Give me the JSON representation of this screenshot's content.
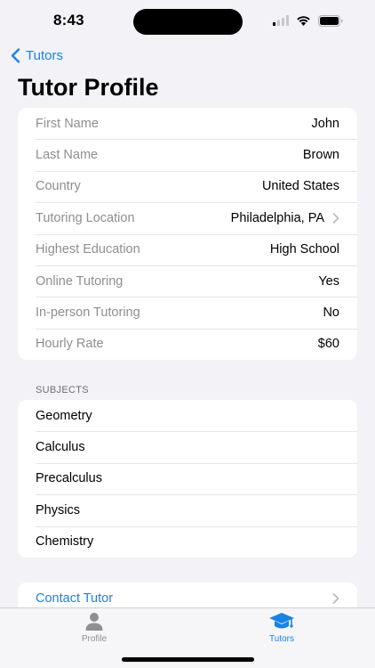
{
  "status_bar": {
    "time": "8:43"
  },
  "nav": {
    "back_label": "Tutors",
    "title": "Tutor Profile"
  },
  "profile": {
    "rows": [
      {
        "label": "First Name",
        "value": "John"
      },
      {
        "label": "Last Name",
        "value": "Brown"
      },
      {
        "label": "Country",
        "value": "United States"
      },
      {
        "label": "Tutoring Location",
        "value": "Philadelphia, PA"
      },
      {
        "label": "Highest Education",
        "value": "High School"
      },
      {
        "label": "Online Tutoring",
        "value": "Yes"
      },
      {
        "label": "In-person Tutoring",
        "value": "No"
      },
      {
        "label": "Hourly Rate",
        "value": "$60"
      }
    ]
  },
  "subjects": {
    "header": "SUBJECTS",
    "items": [
      "Geometry",
      "Calculus",
      "Precalculus",
      "Physics",
      "Chemistry"
    ]
  },
  "contact": {
    "label": "Contact Tutor"
  },
  "tab_bar": {
    "tabs": [
      {
        "label": "Profile",
        "icon": "person-icon"
      },
      {
        "label": "Tutors",
        "icon": "graduation-cap-icon"
      }
    ],
    "active_color": "#1a82e6",
    "inactive_color": "#8e8e93"
  },
  "colors": {
    "accent": "#1a82e6",
    "background": "#f2f2f7"
  }
}
